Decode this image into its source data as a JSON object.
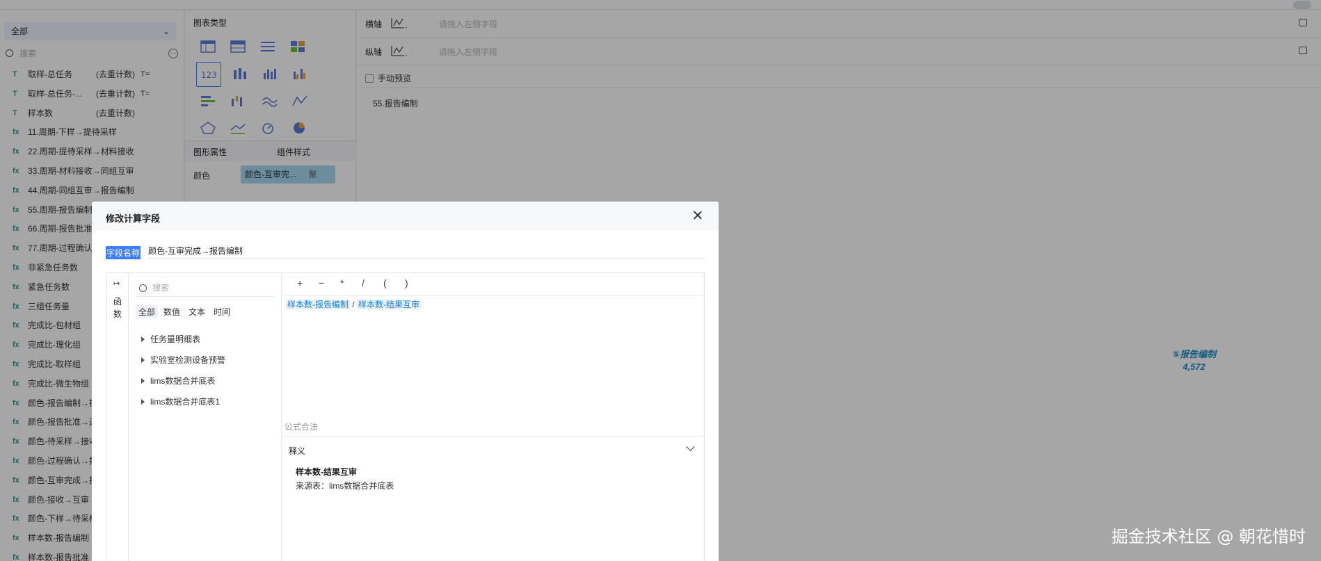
{
  "sidebar": {
    "select_label": "全部",
    "search_placeholder": "搜索",
    "fields": [
      {
        "icon": "T",
        "label": "取样-总任务",
        "agg": "(去重计数)",
        "filter": "T="
      },
      {
        "icon": "T",
        "label": "取样-总任务-...",
        "agg": "(去重计数)",
        "filter": "T="
      },
      {
        "icon": "T",
        "label": "样本数",
        "agg": "(去重计数)",
        "filter": ""
      },
      {
        "icon": "fx",
        "label": "11.周期-下样→提待采样",
        "agg": "",
        "filter": ""
      },
      {
        "icon": "fx",
        "label": "22.周期-提待采样→材料接收",
        "agg": "",
        "filter": ""
      },
      {
        "icon": "fx",
        "label": "33.周期-材料接收→同组互审",
        "agg": "",
        "filter": ""
      },
      {
        "icon": "fx",
        "label": "44.周期-同组互审→报告编制",
        "agg": "",
        "filter": ""
      },
      {
        "icon": "fx",
        "label": "55.周期-报告编制",
        "agg": "",
        "filter": ""
      },
      {
        "icon": "fx",
        "label": "66.周期-报告批准",
        "agg": "",
        "filter": ""
      },
      {
        "icon": "fx",
        "label": "77.周期-过程确认",
        "agg": "",
        "filter": ""
      },
      {
        "icon": "fx",
        "label": "非紧急任务数",
        "agg": "",
        "filter": ""
      },
      {
        "icon": "fx",
        "label": "紧急任务数",
        "agg": "",
        "filter": ""
      },
      {
        "icon": "fx",
        "label": "三组任务量",
        "agg": "",
        "filter": ""
      },
      {
        "icon": "fx",
        "label": "完成比-包材组",
        "agg": "",
        "filter": ""
      },
      {
        "icon": "fx",
        "label": "完成比-理化组",
        "agg": "",
        "filter": ""
      },
      {
        "icon": "fx",
        "label": "完成比-取样组",
        "agg": "",
        "filter": ""
      },
      {
        "icon": "fx",
        "label": "完成比-微生物组",
        "agg": "",
        "filter": ""
      },
      {
        "icon": "fx",
        "label": "颜色-报告编制→批",
        "agg": "",
        "filter": ""
      },
      {
        "icon": "fx",
        "label": "颜色-报告批准→过",
        "agg": "",
        "filter": ""
      },
      {
        "icon": "fx",
        "label": "颜色-待采样→接收",
        "agg": "",
        "filter": ""
      },
      {
        "icon": "fx",
        "label": "颜色-过程确认→报",
        "agg": "",
        "filter": ""
      },
      {
        "icon": "fx",
        "label": "颜色-互审完成→报",
        "agg": "",
        "filter": ""
      },
      {
        "icon": "fx",
        "label": "颜色-接收→互审",
        "agg": "",
        "filter": ""
      },
      {
        "icon": "fx",
        "label": "颜色-下样→待采样",
        "agg": "",
        "filter": ""
      },
      {
        "icon": "fx",
        "label": "样本数-报告编制",
        "agg": "",
        "filter": ""
      },
      {
        "icon": "fx",
        "label": "样本数-报告批准",
        "agg": "",
        "filter": ""
      }
    ]
  },
  "config": {
    "chart_type_title": "图表类型",
    "tab_shape": "图形属性",
    "tab_style": "组件样式",
    "color_label": "颜色",
    "color_chip": "颜色-互审完...",
    "color_chip_suffix": "聚"
  },
  "canvas": {
    "x_axis_label": "横轴",
    "y_axis_label": "纵轴",
    "axis_placeholder": "请拖入左侧字段",
    "manual_preview": "手动预览",
    "component_title": "55.报告编制",
    "kpi_label": "⑤报告编制",
    "kpi_value": "4,572"
  },
  "modal": {
    "title": "修改计算字段",
    "name_label": "字段名称",
    "name_value": "颜色-互审完成→报告编制",
    "rail_label": "函数",
    "fn_search_placeholder": "搜索",
    "fn_tabs": [
      "全部",
      "数值",
      "文本",
      "时间"
    ],
    "tree": [
      "任务量明细表",
      "实验室检测设备预警",
      "lims数据合并底表",
      "lims数据合并底表1"
    ],
    "operators": [
      "+",
      "−",
      "*",
      "/",
      "(",
      ")"
    ],
    "formula_token_1": "样本数-报告编制",
    "formula_op": " / ",
    "formula_token_2": "样本数-结果互审",
    "validation": "公式合法",
    "desc_header": "释义",
    "desc_field": "样本数-结果互审",
    "desc_source": "来源表：lims数据合并底表"
  },
  "watermark": "掘金技术社区 @ 朝花惜时",
  "colors": {
    "accent": "#3d7eff",
    "kpi": "#1c8fc6",
    "chip": "#a8d8f0"
  }
}
